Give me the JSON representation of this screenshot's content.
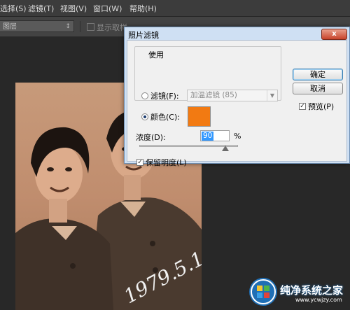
{
  "menubar": {
    "items": [
      "选择(S)",
      "滤镜(T)",
      "视图(V)",
      "窗口(W)",
      "帮助(H)"
    ]
  },
  "options_bar": {
    "layer_select": "图层",
    "show_sampling_label": "显示取样"
  },
  "dialog": {
    "title": "照片滤镜",
    "close_glyph": "x",
    "use_group_label": "使用",
    "filter_radio_label": "滤镜(F):",
    "filter_value": "加温滤镜 (85)",
    "color_radio_label": "颜色(C):",
    "selected_option": "color",
    "color_swatch": "#f27a12",
    "ok_label": "确定",
    "cancel_label": "取消",
    "preview_label": "预览(P)",
    "preview_checked": true,
    "density_label": "浓度(D):",
    "density_value": "90",
    "density_unit": "%",
    "density_percent": 90,
    "preserve_luminosity_label": "保留明度(L)",
    "preserve_luminosity_checked": true
  },
  "photo": {
    "handwriting": "1979.5.1"
  },
  "watermark": {
    "brand": "纯净系统之家",
    "url": "www.ycwjzy.com"
  },
  "colors": {
    "accent_blue": "#3399ff",
    "dialog_frame": "#cfe0f3",
    "close_red": "#c7432a"
  }
}
